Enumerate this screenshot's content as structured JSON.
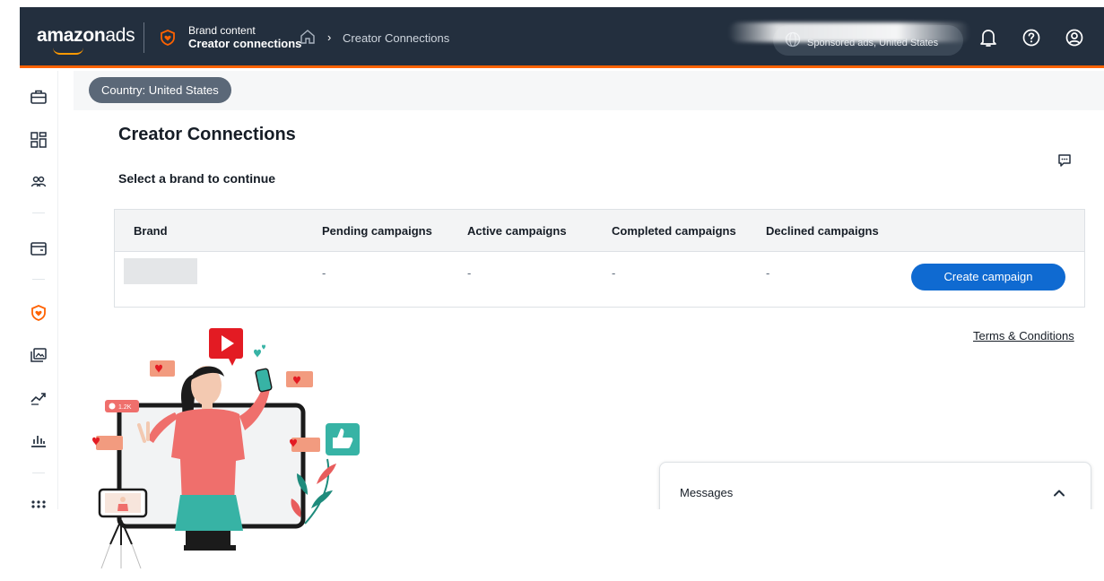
{
  "header": {
    "logo": {
      "part1": "amazon",
      "part2": "ads"
    },
    "section_label": "Brand content",
    "section_title": "Creator connections",
    "breadcrumb": "Creator Connections",
    "account_subtitle": "Sponsored ads, United States"
  },
  "filters": {
    "country": "Country: United States"
  },
  "main": {
    "title": "Creator Connections",
    "subtitle": "Select a brand to continue",
    "table": {
      "columns": [
        "Brand",
        "Pending campaigns",
        "Active campaigns",
        "Completed campaigns",
        "Declined campaigns"
      ],
      "rows": [
        {
          "brand": "",
          "pending": "-",
          "active": "-",
          "completed": "-",
          "declined": "-",
          "action": "Create campaign"
        }
      ]
    },
    "terms": "Terms & Conditions"
  },
  "messages": {
    "label": "Messages"
  },
  "illustration": {
    "badge_count": "1.2K"
  },
  "colors": {
    "topbar": "#232f3e",
    "accent": "#ff6200",
    "primary_button": "#0f6ad1"
  },
  "icons": [
    "shield-heart-icon",
    "home-icon",
    "globe-icon",
    "bell-icon",
    "help-icon",
    "user-icon",
    "briefcase-icon",
    "dashboard-icon",
    "people-icon",
    "wallet-icon",
    "analytics-icon",
    "chart-icon",
    "apps-icon",
    "feedback-icon",
    "chevron-up-icon"
  ]
}
